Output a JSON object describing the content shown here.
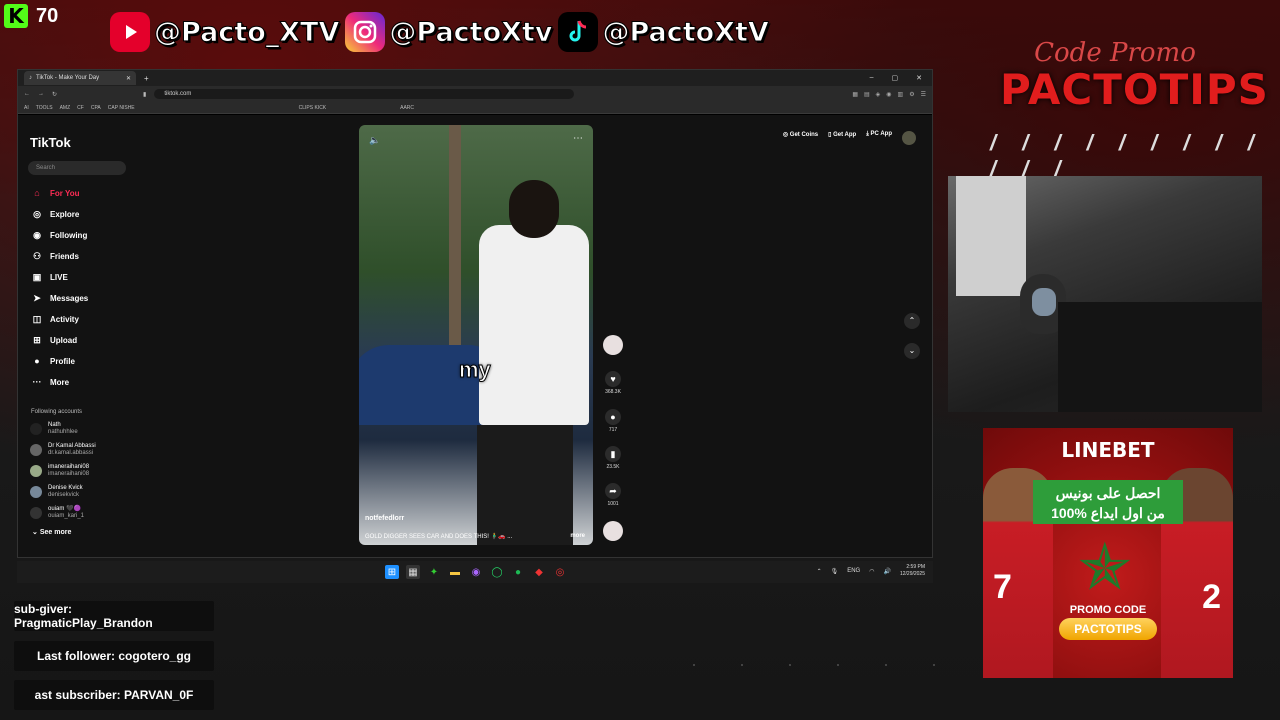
{
  "kick": {
    "logo": "K",
    "viewers": "70"
  },
  "socials": [
    {
      "icon": "youtube-icon",
      "handle": "@Pacto_XTV"
    },
    {
      "icon": "instagram-icon",
      "handle": "@PactoXtv"
    },
    {
      "icon": "tiktok-icon",
      "handle": "@PactoXtV"
    }
  ],
  "promo": {
    "script": "Code Promo",
    "code": "PACTOTIPS",
    "slashes": "/ / / / / / / / / / / /"
  },
  "ad": {
    "brand": "LINEBET",
    "line1": "احصل على بونيس",
    "line2": "100% من اول ايداع",
    "promo_label": "PROMO CODE",
    "promo_code": "PACTOTIPS",
    "jersey1": "7",
    "jersey2": "2"
  },
  "alerts": {
    "sub_giver": "sub-giver: PragmaticPlay_Brandon",
    "last_follower": "Last follower: cogotero_gg",
    "last_subscriber": "ast subscriber: PARVAN_0F"
  },
  "browser": {
    "tab_title": "TikTok - Make Your Day",
    "url": "tiktok.com",
    "bookmarks": [
      "AI",
      "TOOLS",
      "AMZ",
      "CF",
      "CPA",
      "CAP NISHE",
      "CLIPS KICK",
      "AARC"
    ]
  },
  "tiktok": {
    "brand": "TikTok",
    "search_placeholder": "Search",
    "nav": [
      "For You",
      "Explore",
      "Following",
      "Friends",
      "LIVE",
      "Messages",
      "Activity",
      "Upload",
      "Profile",
      "More"
    ],
    "following_title": "Following accounts",
    "accounts": [
      {
        "name": "Nath",
        "handle": "nathuhhlee"
      },
      {
        "name": "Dr Kamal Abbassi",
        "handle": "dr.kamal.abbassi"
      },
      {
        "name": "imaneraihani08",
        "handle": "imaneraihani08"
      },
      {
        "name": "Denise Kvick",
        "handle": "denisekvick"
      },
      {
        "name": "ouiam 🖤🟣",
        "handle": "ouiam_kari_1"
      }
    ],
    "see_more": "See more",
    "top_buttons": [
      "Get Coins",
      "Get App",
      "PC App"
    ],
    "video": {
      "caption": "my",
      "username": "notfefedlorr",
      "description": "GOLD DIGGER SEES CAR AND DOES THIS! 🧍‍♂️🚗 ...",
      "more": "more"
    },
    "counts": {
      "likes": "368.3K",
      "comments": "717",
      "saves": "23.5K",
      "shares": "1001"
    }
  },
  "taskbar": {
    "lang": "ENG",
    "time": "2:59 PM",
    "date": "12/29/2025"
  }
}
